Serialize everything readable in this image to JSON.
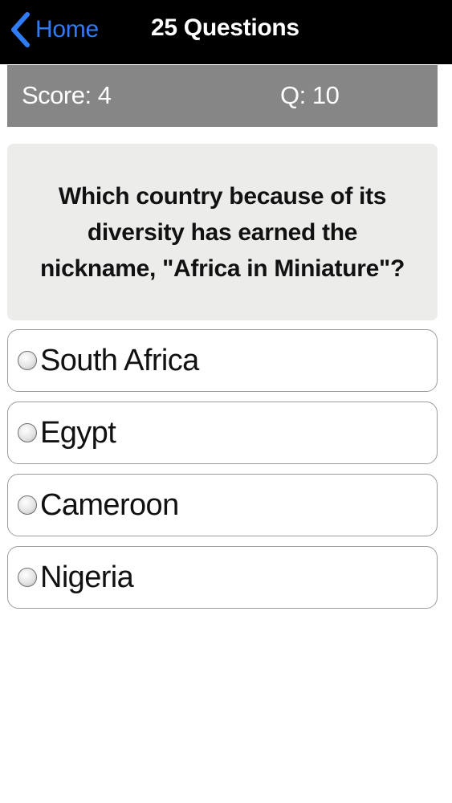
{
  "navbar": {
    "back_label": "Home",
    "title": "25 Questions"
  },
  "status": {
    "score": "Score: 4",
    "question_number": "Q: 10"
  },
  "question": {
    "text": "Which country because of its diversity has earned the nickname, \"Africa in Miniature\"?"
  },
  "answers": [
    {
      "label": "South Africa"
    },
    {
      "label": "Egypt"
    },
    {
      "label": "Cameroon"
    },
    {
      "label": "Nigeria"
    }
  ],
  "colors": {
    "navbar_bg": "#000000",
    "back_blue": "#2f7cf6",
    "scorebar_bg": "#868686",
    "question_bg": "#ececea"
  },
  "icons": {
    "back": "chevron-left-icon",
    "option": "radio-button-icon"
  }
}
